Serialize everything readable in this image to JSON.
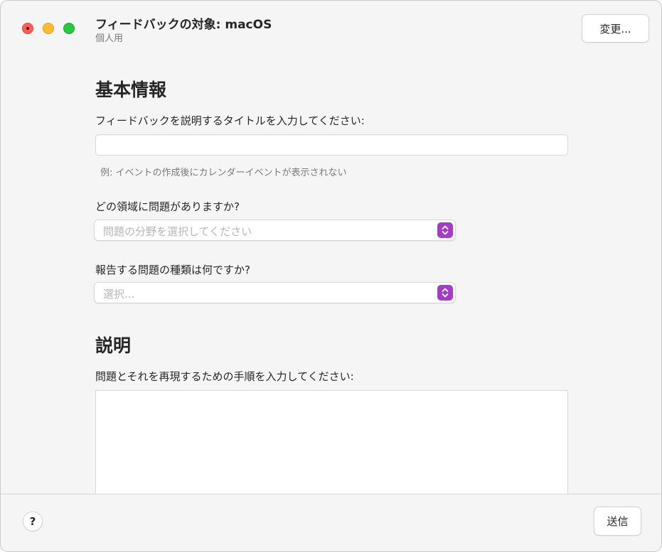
{
  "window": {
    "title": "フィードバックの対象: macOS",
    "subtitle": "個人用",
    "change_button": "変更..."
  },
  "basic_info": {
    "heading": "基本情報",
    "title_prompt": "フィードバックを説明するタイトルを入力してください:",
    "title_value": "",
    "title_example": "例: イベントの作成後にカレンダーイベントが表示されない",
    "area_prompt": "どの領域に問題がありますか?",
    "area_placeholder": "問題の分野を選択してください",
    "type_prompt": "報告する問題の種類は何ですか?",
    "type_placeholder": "選択..."
  },
  "description": {
    "heading": "説明",
    "steps_prompt": "問題とそれを再現するための手順を入力してください:",
    "steps_value": ""
  },
  "footer": {
    "help_label": "?",
    "send_button": "送信"
  },
  "colors": {
    "accent": "#a33dc5",
    "close": "#ff5f57",
    "minimize": "#febc2e",
    "zoom": "#28c840"
  },
  "icons": {
    "close": "close-icon",
    "minimize": "minimize-icon",
    "zoom": "zoom-icon",
    "stepper": "chevron-up-down-icon",
    "help": "help-icon"
  }
}
